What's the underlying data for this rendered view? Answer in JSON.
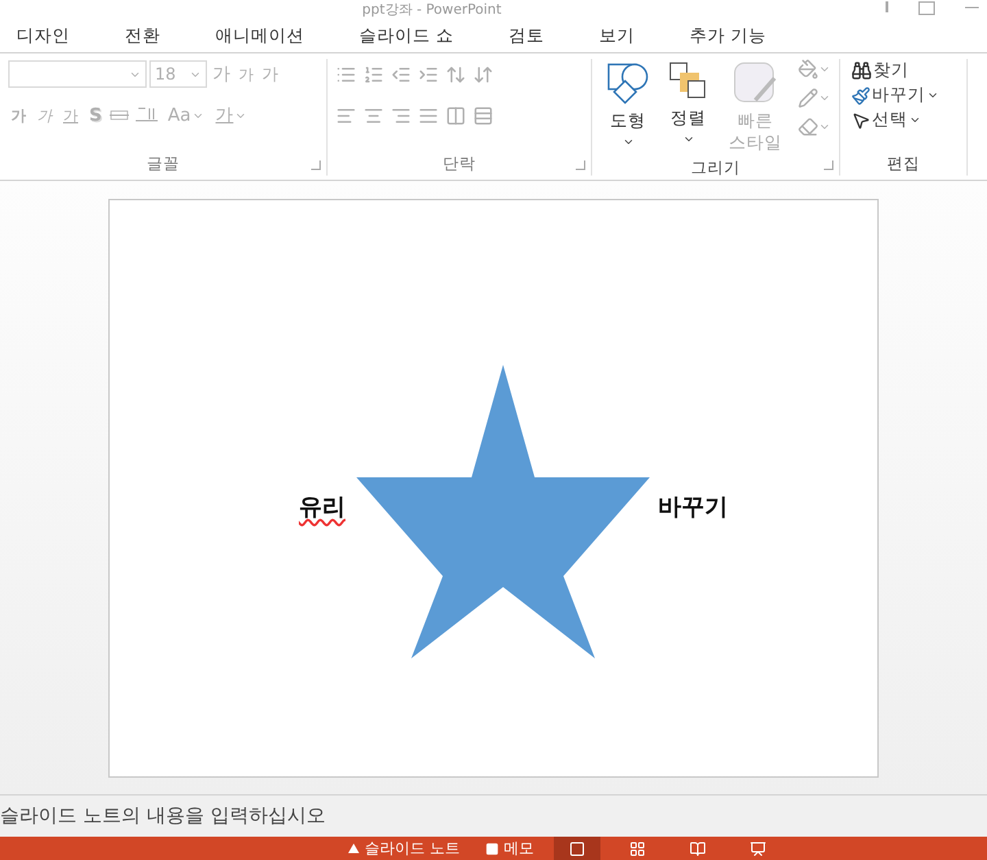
{
  "window": {
    "title": "ppt강좌 - PowerPoint"
  },
  "tabs": [
    {
      "label": "디자인",
      "selected": false
    },
    {
      "label": "전환",
      "selected": false
    },
    {
      "label": "애니메이션",
      "selected": false
    },
    {
      "label": "슬라이드 쇼",
      "selected": false
    },
    {
      "label": "검토",
      "selected": false
    },
    {
      "label": "보기",
      "selected": false
    },
    {
      "label": "추가 기능",
      "selected": false
    }
  ],
  "font_group": {
    "label": "글꼴",
    "disabled": true,
    "size": "18",
    "grow": "가",
    "shrink": "가",
    "clear": "가",
    "bold": "가",
    "italic": "가",
    "underline": "가",
    "shadow": "S",
    "change_case": "Aa",
    "font_color": "가"
  },
  "paragraph_group": {
    "label": "단락",
    "disabled": true
  },
  "drawing_group": {
    "label": "그리기",
    "shapes": {
      "label": "도형",
      "disabled": false
    },
    "arrange": {
      "label": "정렬",
      "disabled": false
    },
    "quick_styles": {
      "label": "빠른 스타일",
      "disabled": true
    },
    "format_disabled": true
  },
  "editing_group": {
    "label": "편집",
    "find": "찾기",
    "replace": "바꾸기",
    "select": "선택"
  },
  "slide": {
    "text_left": "유리",
    "spell_error": true,
    "text_right": "바꾸기"
  },
  "notes": {
    "placeholder": "슬라이드 노트의 내용을 입력하십시오"
  },
  "status_bar": {
    "notes_button": "슬라이드 노트",
    "comments_button": "메모",
    "views": [
      {
        "selected": true
      },
      {
        "selected": false
      },
      {
        "selected": false
      },
      {
        "selected": false
      }
    ]
  }
}
